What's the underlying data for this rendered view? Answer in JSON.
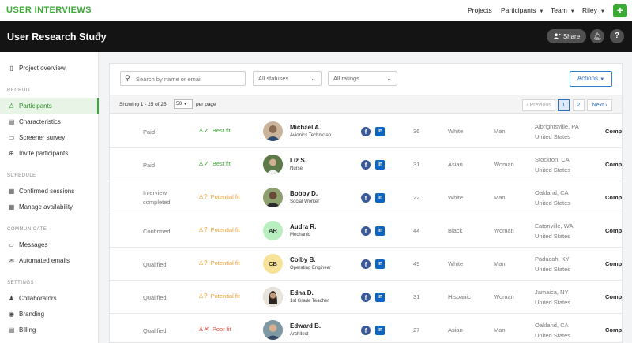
{
  "app": {
    "logo": "USER INTERVIEWS",
    "nav": {
      "projects": "Projects",
      "participants": "Participants",
      "team": "Team",
      "user": "Riley",
      "add": "+"
    }
  },
  "header": {
    "title": "User Research Study",
    "share": "Share",
    "help": "?"
  },
  "sidebar": {
    "overview": "Project overview",
    "sections": {
      "recruit": "RECRUIT",
      "schedule": "SCHEDULE",
      "communicate": "COMMUNICATE",
      "settings": "SETTINGS"
    },
    "items": [
      {
        "label": "Participants",
        "icon": "person-icon"
      },
      {
        "label": "Characteristics",
        "icon": "id-card-icon"
      },
      {
        "label": "Screener survey",
        "icon": "clipboard-icon"
      },
      {
        "label": "Invite participants",
        "icon": "plus-circle-icon"
      },
      {
        "label": "Confirmed sessions",
        "icon": "calendar-check-icon"
      },
      {
        "label": "Manage availability",
        "icon": "calendar-icon"
      },
      {
        "label": "Messages",
        "icon": "chat-icon"
      },
      {
        "label": "Automated emails",
        "icon": "envelope-icon"
      },
      {
        "label": "Collaborators",
        "icon": "users-icon"
      },
      {
        "label": "Branding",
        "icon": "palette-icon"
      },
      {
        "label": "Billing",
        "icon": "receipt-icon"
      }
    ]
  },
  "filters": {
    "search_placeholder": "Search by name or email",
    "status": "All statuses",
    "ratings": "All ratings",
    "actions": "Actions"
  },
  "paging": {
    "showing": "Showing 1 - 25 of 25",
    "per_page_value": "50",
    "per_page_label": "per page",
    "previous": "‹ Previous",
    "page1": "1",
    "page2": "2",
    "next": "Next ›"
  },
  "rows": [
    {
      "status": "Paid",
      "fit": "Best fit",
      "fit_color": "#3aaa35",
      "name": "Michael A.",
      "title": "Avionics Technician",
      "age": "36",
      "race": "White",
      "gender": "Man",
      "city": "Albrightsville, PA",
      "country": "United States",
      "comp": "Comp",
      "avatar_bg": "#c9b39a"
    },
    {
      "status": "Paid",
      "fit": "Best fit",
      "fit_color": "#3aaa35",
      "name": "Liz S.",
      "title": "Nurse",
      "age": "31",
      "race": "Asian",
      "gender": "Woman",
      "city": "Stockton, CA",
      "country": "United States",
      "comp": "Comp",
      "avatar_bg": "#6f8a5a"
    },
    {
      "status": "Interview completed",
      "fit": "Potential fit",
      "fit_color": "#f0a030",
      "name": "Bobby D.",
      "title": "Social Worker",
      "age": "22",
      "race": "White",
      "gender": "Man",
      "city": "Oakland, CA",
      "country": "United States",
      "comp": "Comp",
      "avatar_bg": "#7a6a58"
    },
    {
      "status": "Confirmed",
      "fit": "Potential fit",
      "fit_color": "#f0a030",
      "name": "Audra R.",
      "title": "Mechanic",
      "age": "44",
      "race": "Black",
      "gender": "Woman",
      "city": "Eatonville, WA",
      "country": "United States",
      "comp": "Comp",
      "initials": "AR",
      "avatar_bg": "#b9eec0"
    },
    {
      "status": "Qualified",
      "fit": "Potential fit",
      "fit_color": "#f0a030",
      "name": "Colby B.",
      "title": "Operating Engineer",
      "age": "49",
      "race": "White",
      "gender": "Man",
      "city": "Paducah, KY",
      "country": "United States",
      "comp": "Comp",
      "initials": "CB",
      "avatar_bg": "#f7e29a"
    },
    {
      "status": "Qualified",
      "fit": "Potential fit",
      "fit_color": "#f0a030",
      "name": "Edna D.",
      "title": "1st Grade Teacher",
      "age": "31",
      "race": "Hispanic",
      "gender": "Woman",
      "city": "Jamaica, NY",
      "country": "United States",
      "comp": "Comp",
      "avatar_bg": "#9a8070"
    },
    {
      "status": "Qualified",
      "fit": "Poor fit",
      "fit_color": "#e84b3c",
      "name": "Edward B.",
      "title": "Architect",
      "age": "27",
      "race": "Asian",
      "gender": "Man",
      "city": "Oakland, CA",
      "country": "United States",
      "comp": "Comp",
      "avatar_bg": "#8ea0a8"
    }
  ]
}
